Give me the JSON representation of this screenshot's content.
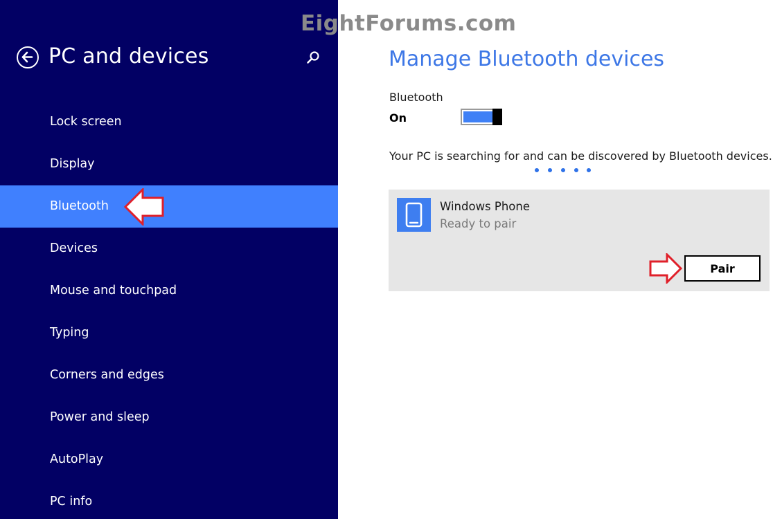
{
  "watermark": "EightForums.com",
  "sidebar": {
    "title": "PC and devices",
    "items": [
      {
        "label": "Lock screen",
        "selected": false
      },
      {
        "label": "Display",
        "selected": false
      },
      {
        "label": "Bluetooth",
        "selected": true
      },
      {
        "label": "Devices",
        "selected": false
      },
      {
        "label": "Mouse and touchpad",
        "selected": false
      },
      {
        "label": "Typing",
        "selected": false
      },
      {
        "label": "Corners and edges",
        "selected": false
      },
      {
        "label": "Power and sleep",
        "selected": false
      },
      {
        "label": "AutoPlay",
        "selected": false
      },
      {
        "label": "PC info",
        "selected": false
      }
    ]
  },
  "main": {
    "title": "Manage Bluetooth devices",
    "bluetooth": {
      "label": "Bluetooth",
      "state": "On",
      "enabled": true
    },
    "search_status": "Your PC is searching for and can be discovered by Bluetooth devices.",
    "device": {
      "name": "Windows Phone",
      "status": "Ready to pair",
      "icon": "phone-icon",
      "pair_label": "Pair"
    }
  },
  "colors": {
    "sidebar_bg": "#020064",
    "selected_bg": "#4080fe",
    "accent": "#3d77e6",
    "card_bg": "#e6e6e6",
    "annotation_arrow": "#e0202a"
  },
  "icons": {
    "back": "back-arrow-icon",
    "search": "search-icon",
    "annotation": "arrow-annotation-icon"
  }
}
